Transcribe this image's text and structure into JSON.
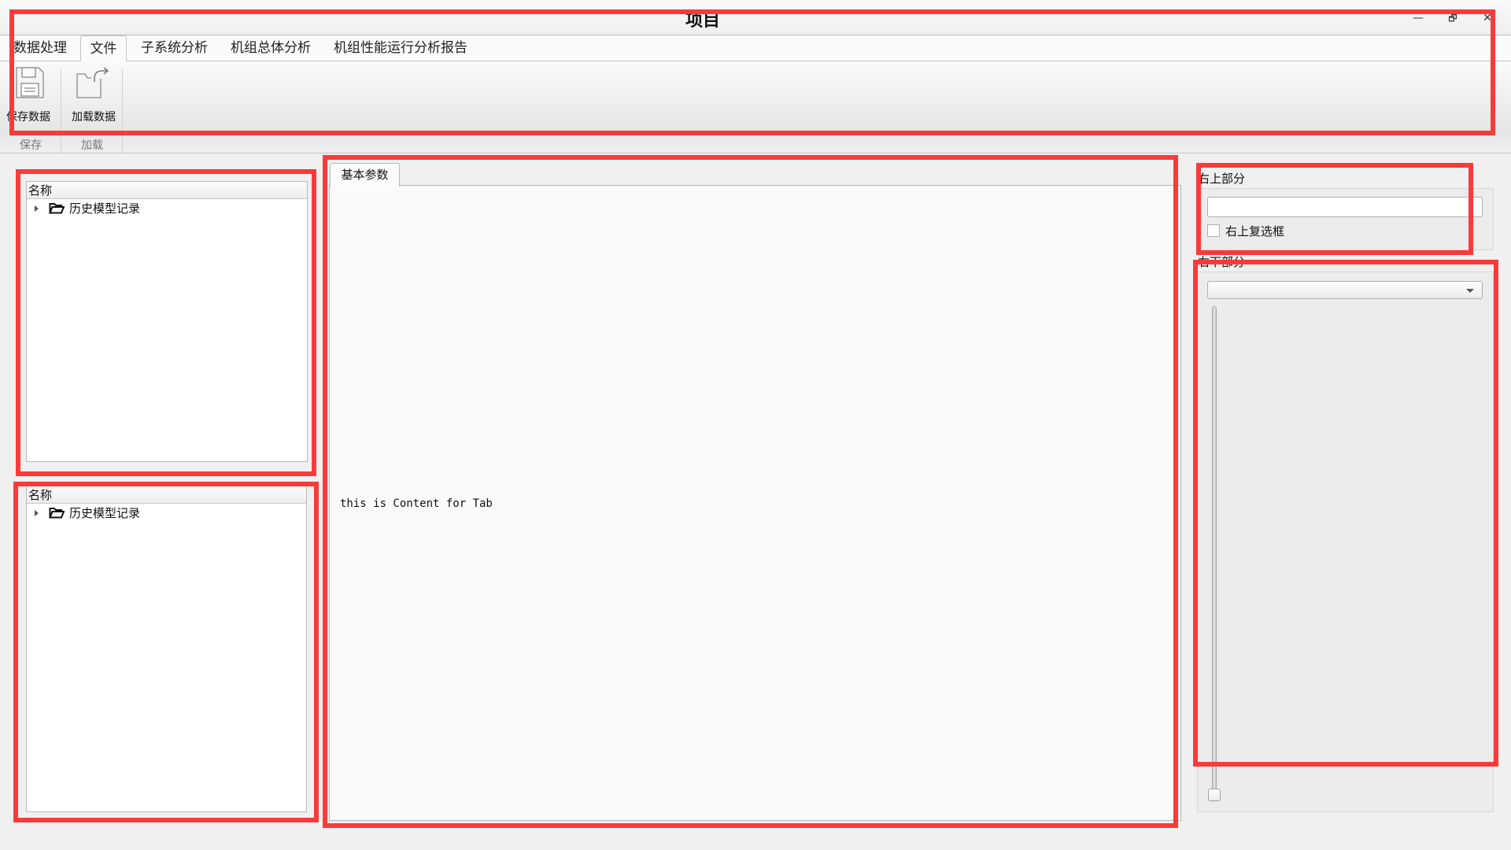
{
  "window": {
    "title": "项目",
    "controls": {
      "minimize": "—",
      "restore": "🗗",
      "close": "✕"
    }
  },
  "menu": {
    "tabs": [
      {
        "label": "数据处理",
        "selected": false
      },
      {
        "label": "文件",
        "selected": true
      },
      {
        "label": "子系统分析",
        "selected": false
      },
      {
        "label": "机组总体分析",
        "selected": false
      },
      {
        "label": "机组性能运行分析报告",
        "selected": false
      }
    ]
  },
  "ribbon": {
    "groups": [
      {
        "label": "保存",
        "buttons": [
          {
            "label": "保存数据",
            "icon": "floppy-disk-icon"
          }
        ]
      },
      {
        "label": "加载",
        "buttons": [
          {
            "label": "加载数据",
            "icon": "folder-export-icon"
          }
        ]
      }
    ]
  },
  "left": {
    "trees": [
      {
        "header": "名称",
        "items": [
          {
            "label": "历史模型记录",
            "icon": "folder-open-icon",
            "expanded": false
          }
        ]
      },
      {
        "header": "名称",
        "items": [
          {
            "label": "历史模型记录",
            "icon": "folder-open-icon",
            "expanded": false
          }
        ]
      }
    ]
  },
  "center": {
    "tabs": [
      {
        "label": "基本参数",
        "selected": true
      }
    ],
    "content": "this is Content for Tab"
  },
  "right": {
    "top_group": {
      "title": "右上部分",
      "input_value": "",
      "checkbox_label": "右上复选框",
      "checkbox_checked": false
    },
    "bottom_group": {
      "title": "右下部分",
      "combo_value": "",
      "slider_value_fraction": 0.0
    }
  }
}
